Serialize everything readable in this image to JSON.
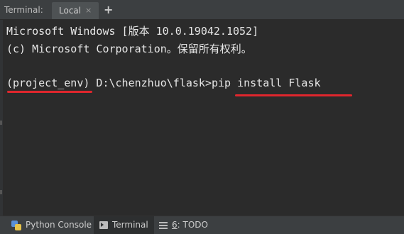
{
  "tab_bar": {
    "title": "Terminal:",
    "active_tab": "Local",
    "close_symbol": "×",
    "add_symbol": "+"
  },
  "terminal": {
    "lines": [
      "Microsoft Windows [版本 10.0.19042.1052]",
      "(c) Microsoft Corporation。保留所有权利。",
      "",
      "(project_env) D:\\chenzhuo\\flask>pip install Flask"
    ],
    "prompt_env": "(project_env)",
    "prompt_path": " D:\\chenzhuo\\flask>",
    "command": "pip install Flask",
    "annotation_color": "#e0262d"
  },
  "bottom_bar": {
    "tabs": [
      {
        "label": "Python Console",
        "icon": "python-icon",
        "active": false
      },
      {
        "label": "Terminal",
        "icon": "terminal-icon",
        "active": true
      },
      {
        "hotkey": "6",
        "label": ": TODO",
        "icon": "todo-list-icon",
        "active": false
      }
    ]
  }
}
